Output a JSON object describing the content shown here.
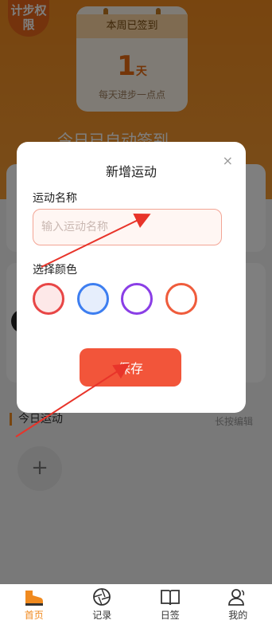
{
  "header": {
    "badge_label": "计步权限",
    "sign_card": {
      "title": "本周已签到",
      "count": "1",
      "unit": "天",
      "subtitle": "每天进步一点点"
    },
    "auto_sign": "今日已自动签到"
  },
  "main": {
    "section_title": "今日运动",
    "long_press_hint": "长按编辑",
    "add_label": "+"
  },
  "dialog": {
    "title": "新增运动",
    "close_label": "×",
    "name_label": "运动名称",
    "name_placeholder": "输入运动名称",
    "name_value": "",
    "color_label": "选择颜色",
    "colors": [
      {
        "name": "red",
        "border": "#e84646",
        "fill": "#fde8e8",
        "selected": true
      },
      {
        "name": "blue",
        "border": "#3d7ef0",
        "fill": "#e6eefc",
        "selected": false
      },
      {
        "name": "purple",
        "border": "#8a3ee6",
        "fill": "#ffffff",
        "selected": false
      },
      {
        "name": "orange",
        "border": "#ef5c3c",
        "fill": "#ffffff",
        "selected": false
      }
    ],
    "save_label": "保存"
  },
  "tabbar": {
    "items": [
      {
        "label": "首页",
        "icon": "home-shoe-icon",
        "active": true
      },
      {
        "label": "记录",
        "icon": "shutter-icon",
        "active": false
      },
      {
        "label": "日签",
        "icon": "book-icon",
        "active": false
      },
      {
        "label": "我的",
        "icon": "user-icon",
        "active": false
      }
    ]
  },
  "colors": {
    "accent": "#f08a1f",
    "save": "#f2553a",
    "arrow": "#e8342a"
  }
}
